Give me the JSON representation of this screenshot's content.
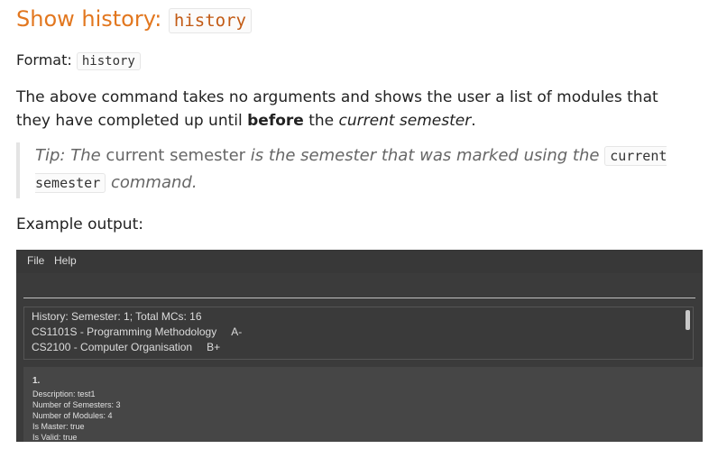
{
  "heading": {
    "text": "Show history: ",
    "code": "history"
  },
  "format": {
    "label": "Format: ",
    "code": "history"
  },
  "description": {
    "part1": "The above command takes no arguments and shows the user a list of modules that they have completed up until ",
    "bold": "before",
    "part2": " the ",
    "italic": "current semester",
    "part3": "."
  },
  "tip": {
    "part1": "Tip: The ",
    "normal": "current semester",
    "part2": " is the semester that was marked using the ",
    "code": "current semester",
    "part3": " command."
  },
  "example_label": "Example output:",
  "app": {
    "menu": [
      "File",
      "Help"
    ],
    "command_value": "",
    "result": {
      "header": "History: Semester: 1; Total MCs: 16",
      "modules": [
        {
          "name": "CS1101S - Programming Methodology",
          "grade": "A-"
        },
        {
          "name": "CS2100 - Computer Organisation",
          "grade": "B+"
        }
      ]
    },
    "card": {
      "index": "1.",
      "lines": [
        "Description: test1",
        "Number of Semesters: 3",
        "Number of Modules: 4",
        "Is Master: true",
        "Is Valid: true"
      ]
    }
  }
}
